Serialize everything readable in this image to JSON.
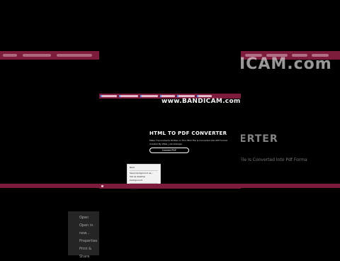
{
  "background": {
    "watermark_partial": "ICAM.com",
    "heading_partial": "ERTER",
    "desc_partial": "File Is Converted Into Pdf Forma",
    "context_menu_partial": [
      "Open",
      "Open in new...",
      "Properties",
      "Print & Share"
    ]
  },
  "window": {
    "watermark": "www.BANDICAM.com",
    "heading": "HTML TO PDF CONVERTER",
    "description_line1": "Make The Contents Written In This Html File Is Converted Into Pdf Format",
    "description_line2": "Created By KNGL_Lite Kolkaga.",
    "convert_button": "Convert PDF",
    "context_menu": [
      "Back",
      "Save background as...",
      "Set as desktop background",
      "Select All",
      "Inspect"
    ]
  },
  "colors": {
    "tabbar": "#7c1b3a",
    "background": "#000000"
  }
}
